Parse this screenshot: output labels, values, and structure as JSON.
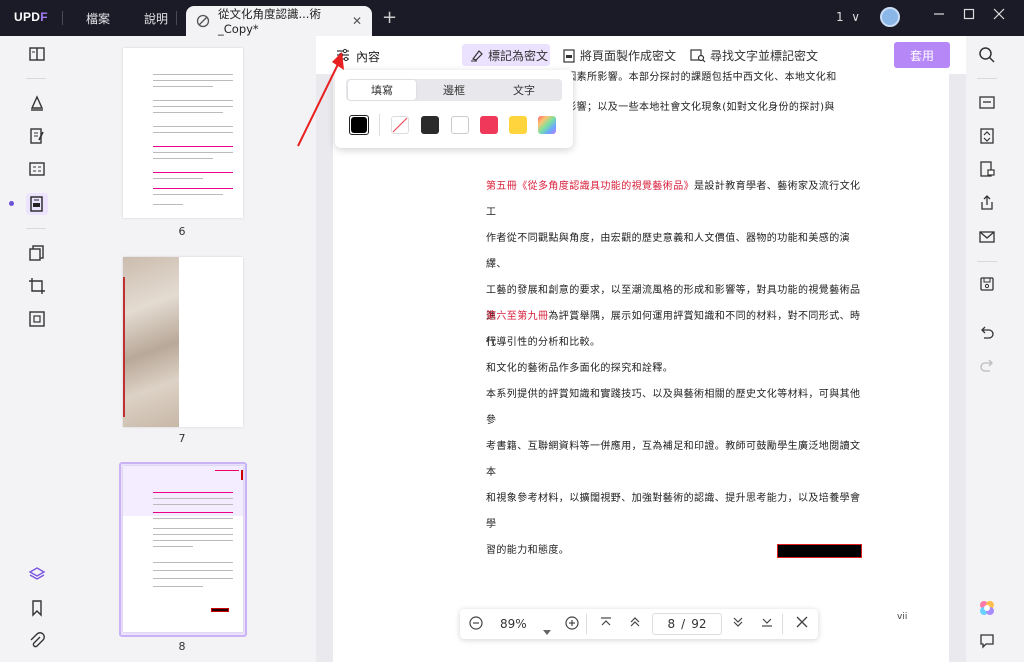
{
  "app": {
    "logo_up": "UPDF",
    "menu": [
      "檔案",
      "說明"
    ],
    "tab_title": "從文化角度認識...術_Copy*",
    "tab_close": "✕",
    "new_tab": "+",
    "window_count": "1",
    "window_count_chevron": "∨"
  },
  "redact_toolbar": {
    "content_label": "內容",
    "mark_label": "標記為密文",
    "page_label": "將頁面製作成密文",
    "find_label": "尋找文字並標記密文",
    "apply_label": "套用"
  },
  "popup": {
    "tabs": [
      "填寫",
      "邊框",
      "文字"
    ],
    "active_tab": "填寫",
    "swatches": [
      "#000000",
      "none",
      "#2b2b2b",
      "#ffffff",
      "#f0385a",
      "#ffd43d",
      "rainbow"
    ]
  },
  "thumbnails": [
    {
      "page": "6"
    },
    {
      "page": "7"
    },
    {
      "page": "8"
    }
  ],
  "document": {
    "top_line1": "閱情境因素所影響。本部分探討的課題包括中西文化、本地文化和",
    "top_line2": "發展的影響；以及一些本地社會文化現象(如對文化身份的探討)與",
    "p1_red": "第五冊《從多角度認識具功能的視覺藝術品》",
    "p1_rest_1": "是設計教育學者、藝術家及流行文化工",
    "p1_line2": "作者從不同觀點與角度，由宏觀的歷史意義和人文價值、器物的功能和美感的演繹、",
    "p1_line3": "工藝的發展和創意的要求，以至潮流風格的形成和影響等，對具功能的視覺藝術品進",
    "p1_line4": "行導引性的分析和比較。",
    "p2_red": "第六至第九冊",
    "p2_rest_1": "為評賞舉隅，展示如何運用評賞知識和不同的材料，對不同形式、時代",
    "p2_line2": "和文化的藝術品作多面化的探究和詮釋。",
    "p3_line1": "本系列提供的評賞知識和實踐技巧、以及與藝術相關的歷史文化等材料，可與其他參",
    "p3_line2": "考書籍、互聯網資料等一併應用，互為補足和印證。教師可鼓勵學生廣泛地閱讀文本",
    "p3_line3": "和視象參考材料，以擴闊視野、加強對藝術的認識、提升思考能力，以及培養學會學",
    "p3_line4": "習的能力和態度。",
    "page_footer": "vii"
  },
  "zoom": {
    "zoom_value": "89%",
    "current_page": "8",
    "separator": "/",
    "total_pages": "92"
  },
  "colors": {
    "accent": "#b587f7",
    "titlebar": "#1b1b27",
    "redline": "#d8203c"
  }
}
